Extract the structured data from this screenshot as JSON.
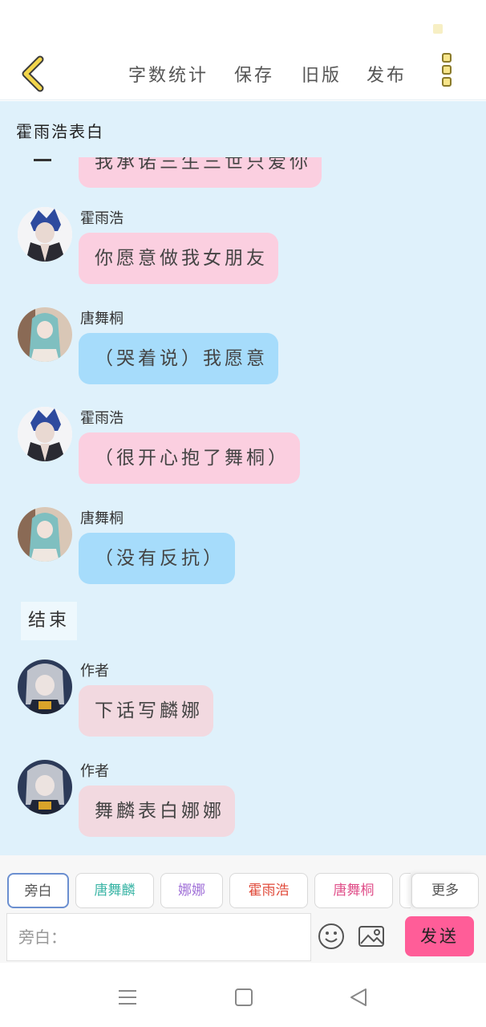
{
  "toolbar": {
    "word_count": "字数统计",
    "save": "保存",
    "old_version": "旧版",
    "publish": "发布"
  },
  "story": {
    "title": "霍雨浩表白"
  },
  "partial_message": {
    "text": "我承诺三生三世只爱你"
  },
  "messages": [
    {
      "name": "霍雨浩",
      "text": "你愿意做我女朋友",
      "color": "pink"
    },
    {
      "name": "唐舞桐",
      "text": "（哭着说）我愿意",
      "color": "blue"
    },
    {
      "name": "霍雨浩",
      "text": "（很开心抱了舞桐）",
      "color": "pink"
    },
    {
      "name": "唐舞桐",
      "text": "（没有反抗）",
      "color": "blue"
    }
  ],
  "narration": "结束",
  "author_messages": [
    {
      "name": "作者",
      "text": "下话写麟娜"
    },
    {
      "name": "作者",
      "text": "舞麟表白娜娜"
    }
  ],
  "role_tabs": [
    {
      "label": "旁白",
      "color": "#555555"
    },
    {
      "label": "唐舞麟",
      "color": "#3bb5a6"
    },
    {
      "label": "娜娜",
      "color": "#a070d8"
    },
    {
      "label": "霍雨浩",
      "color": "#e04a3a"
    },
    {
      "label": "唐舞桐",
      "color": "#e0508a"
    },
    {
      "label": "更多",
      "color": "#555555"
    }
  ],
  "input": {
    "placeholder": "旁白："
  },
  "send_label": "发送",
  "colors": {
    "chat_bg": "#dff1fb",
    "pink_bubble": "#fbcfe0",
    "blue_bubble": "#a6dcfb",
    "send": "#ff5d98",
    "back_arrow": "#f2d54a"
  }
}
